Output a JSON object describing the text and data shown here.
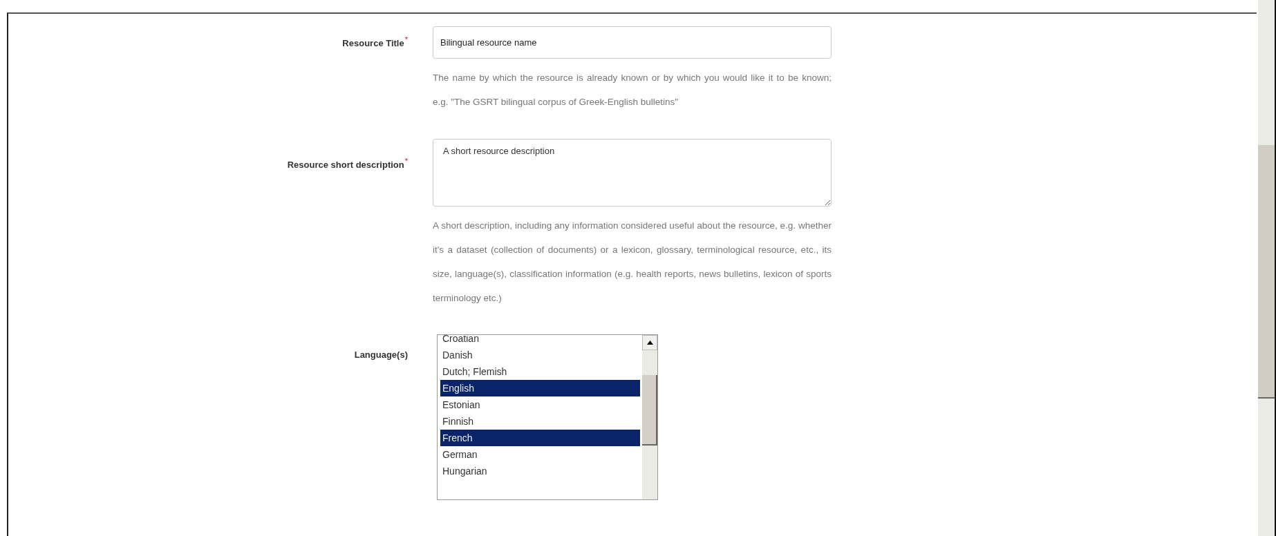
{
  "form": {
    "fields": [
      {
        "kind": "text",
        "label": "Resource Title",
        "required_mark": "*",
        "value": "Bilingual resource name",
        "help": "The name by which the resource is already known or by which you would like it to be known; e.g. \"The GSRT bilingual corpus of Greek-English bulletins\""
      },
      {
        "kind": "textarea",
        "label": "Resource short description",
        "required_mark": "*",
        "value": "A short resource description",
        "help": "A short description, including any information considered useful about the resource, e.g. whether it's a dataset (collection of documents) or a lexicon, glossary, terminological resource, etc., its size, language(s), classification information (e.g. health reports, news bulletins, lexicon of sports terminology etc.)"
      },
      {
        "kind": "listbox",
        "label": "Language(s)",
        "options": [
          {
            "label": "Croatian",
            "selected": false
          },
          {
            "label": "Danish",
            "selected": false
          },
          {
            "label": "Dutch; Flemish",
            "selected": false
          },
          {
            "label": "English",
            "selected": true
          },
          {
            "label": "Estonian",
            "selected": false
          },
          {
            "label": "Finnish",
            "selected": false
          },
          {
            "label": "French",
            "selected": true
          },
          {
            "label": "German",
            "selected": false
          },
          {
            "label": "Hungarian",
            "selected": false
          }
        ]
      }
    ]
  }
}
